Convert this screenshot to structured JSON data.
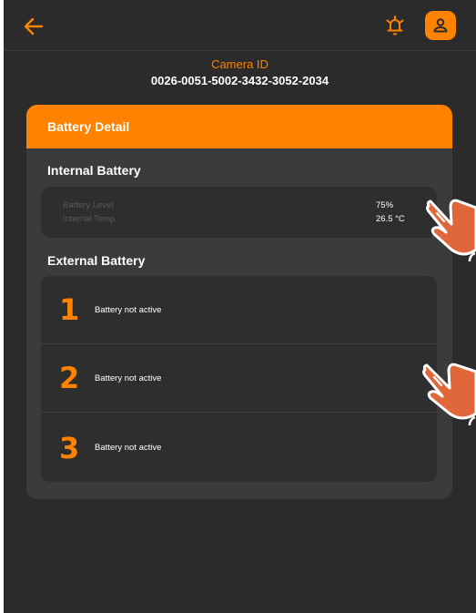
{
  "colors": {
    "accent": "#ff8200",
    "background": "#2b2b2b",
    "card": "#3b3b3b",
    "panel": "#2e2e2e",
    "hand": "#e0673a"
  },
  "header": {
    "back_icon": "arrow-left-icon",
    "alarm_icon": "alarm-bell-icon",
    "profile_icon": "user-icon"
  },
  "camera": {
    "label": "Camera ID",
    "id": "0026-0051-5002-3432-3052-2034"
  },
  "battery_detail": {
    "title": "Battery Detail",
    "internal": {
      "title": "Internal Battery",
      "rows": [
        {
          "label": "Battery Level",
          "value": "75%"
        },
        {
          "label": "Internal Temp",
          "value": "26.5 °C"
        }
      ]
    },
    "external": {
      "title": "External Battery",
      "items": [
        {
          "number": "1",
          "status": "Battery not active"
        },
        {
          "number": "2",
          "status": "Battery not active"
        },
        {
          "number": "3",
          "status": "Battery not active"
        }
      ]
    }
  },
  "overlays": {
    "icon": "pointing-hand-icon"
  }
}
